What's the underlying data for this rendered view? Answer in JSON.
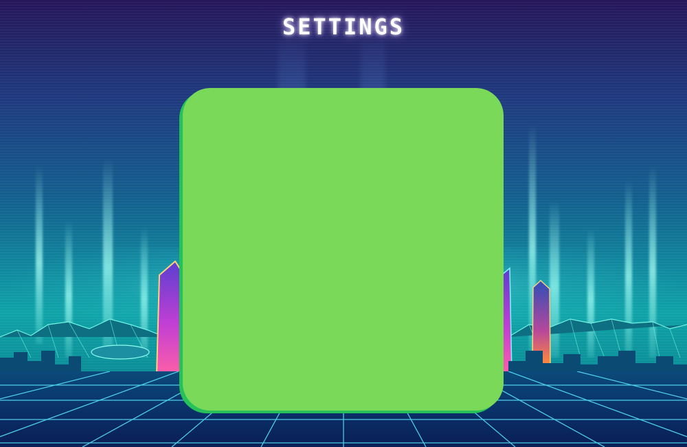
{
  "screen": {
    "title": "SETTINGS"
  },
  "colors": {
    "panel_fill": "#7bd95a",
    "panel_edge": "#27c15a",
    "title_glow": "#c9b8ff",
    "sky_top": "#26175a",
    "neon_cyan": "#5ff6e6"
  },
  "panel": {
    "content": []
  }
}
